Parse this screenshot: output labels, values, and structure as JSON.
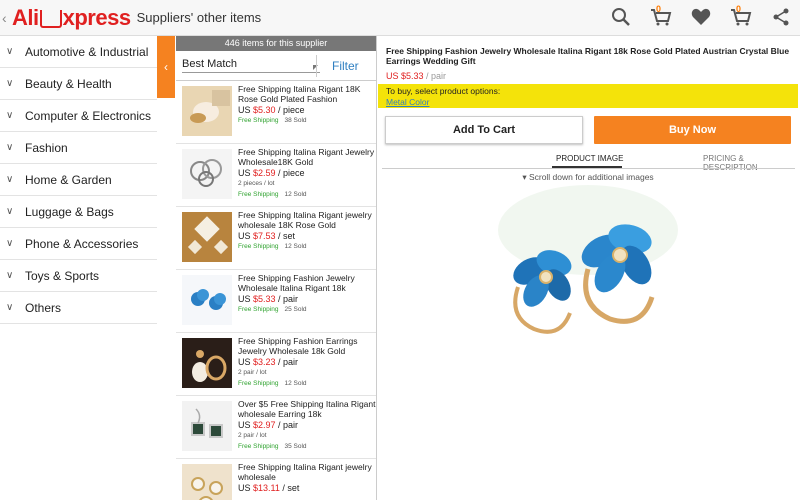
{
  "app": {
    "logo_left": "Ali",
    "logo_right": "xpress",
    "title": "Suppliers' other items",
    "cart_badge_1": "0",
    "cart_badge_2": "0"
  },
  "categories": [
    "Automotive & Industrial",
    "Beauty & Health",
    "Computer & Electronics",
    "Fashion",
    "Home & Garden",
    "Luggage & Bags",
    "Phone & Accessories",
    "Toys & Sports",
    "Others"
  ],
  "items_panel": {
    "count_text": "446 items for this supplier",
    "sort_label": "Best Match",
    "filter_label": "Filter",
    "items": [
      {
        "name": "Free Shipping  Italina Rigant 18K Rose Gold Plated Fashion",
        "currency": "US ",
        "price": "$5.30",
        "unit": " / piece",
        "lot": "",
        "ship": "Free Shipping",
        "sold": "38 Sold"
      },
      {
        "name": "Free Shipping Italina Rigant Jewelry Wholesale18K Gold",
        "currency": "US ",
        "price": "$2.59",
        "unit": " / piece",
        "lot": "2 pieces / lot",
        "ship": "Free Shipping",
        "sold": "12 Sold"
      },
      {
        "name": "Free Shipping Italina Rigant jewelry wholesale 18K Rose Gold",
        "currency": "US ",
        "price": "$7.53",
        "unit": " / set",
        "lot": "",
        "ship": "Free Shipping",
        "sold": "12 Sold"
      },
      {
        "name": "Free Shipping Fashion Jewelry Wholesale Italina Rigant 18k",
        "currency": "US ",
        "price": "$5.33",
        "unit": " / pair",
        "lot": "",
        "ship": "Free Shipping",
        "sold": "25 Sold"
      },
      {
        "name": "Free Shipping Fashion Earrings Jewelry Wholesale 18k Gold",
        "currency": "US ",
        "price": "$3.23",
        "unit": " / pair",
        "lot": "2 pair / lot",
        "ship": "Free Shipping",
        "sold": "12 Sold"
      },
      {
        "name": "Over $5  Free Shipping Italina Rigant wholesale Earring 18k",
        "currency": "US ",
        "price": "$2.97",
        "unit": " / pair",
        "lot": "2 pair / lot",
        "ship": "Free Shipping",
        "sold": "35 Sold"
      },
      {
        "name": "Free Shipping Italina Rigant jewelry wholesale",
        "currency": "US ",
        "price": "$13.11",
        "unit": " / set",
        "lot": "",
        "ship": "",
        "sold": ""
      }
    ]
  },
  "product": {
    "title": "Free Shipping Fashion Jewelry Wholesale Italina Rigant 18k Rose Gold Plated Austrian Crystal  Blue Earrings  Wedding Gift",
    "price": "US $5.33",
    "unit": " / pair",
    "options_text": "To buy, select product options:",
    "options_link": "Metal Color",
    "add_to_cart": "Add To Cart",
    "buy_now": "Buy Now",
    "tab_image": "PRODUCT IMAGE",
    "tab_desc": "PRICING & DESCRIPTION",
    "scroll_note": "▾ Scroll down for additional images"
  },
  "colors": {
    "accent_orange": "#f58220",
    "price_red": "#e02020",
    "link_blue": "#2f7fc1",
    "options_yellow": "#f4e30a",
    "ship_green": "#2fa22f"
  }
}
